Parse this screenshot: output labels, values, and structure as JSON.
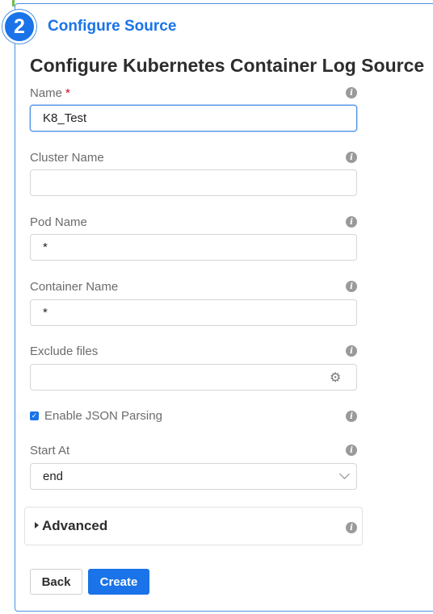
{
  "step": {
    "number": "2",
    "title": "Configure Source"
  },
  "form": {
    "title": "Configure Kubernetes Container Log Source",
    "fields": {
      "name": {
        "label": "Name",
        "required_mark": "*",
        "value": "K8_Test"
      },
      "cluster_name": {
        "label": "Cluster Name",
        "value": ""
      },
      "pod_name": {
        "label": "Pod Name",
        "value": "*"
      },
      "container_name": {
        "label": "Container Name",
        "value": "*"
      },
      "exclude_files": {
        "label": "Exclude files",
        "value": ""
      },
      "enable_json": {
        "label": "Enable JSON Parsing",
        "checked": true
      },
      "start_at": {
        "label": "Start At",
        "value": "end"
      }
    },
    "info_glyph": "i",
    "advanced": {
      "label": "Advanced"
    }
  },
  "actions": {
    "back_label": "Back",
    "create_label": "Create"
  },
  "colors": {
    "accent": "#1a73e8",
    "required": "#d0021b",
    "border_focus": "#4a90e2"
  },
  "icons": {
    "info": "info-icon",
    "gear": "gear-icon",
    "chevron": "chevron-down-icon",
    "caret": "caret-right-icon",
    "check": "check-icon"
  }
}
